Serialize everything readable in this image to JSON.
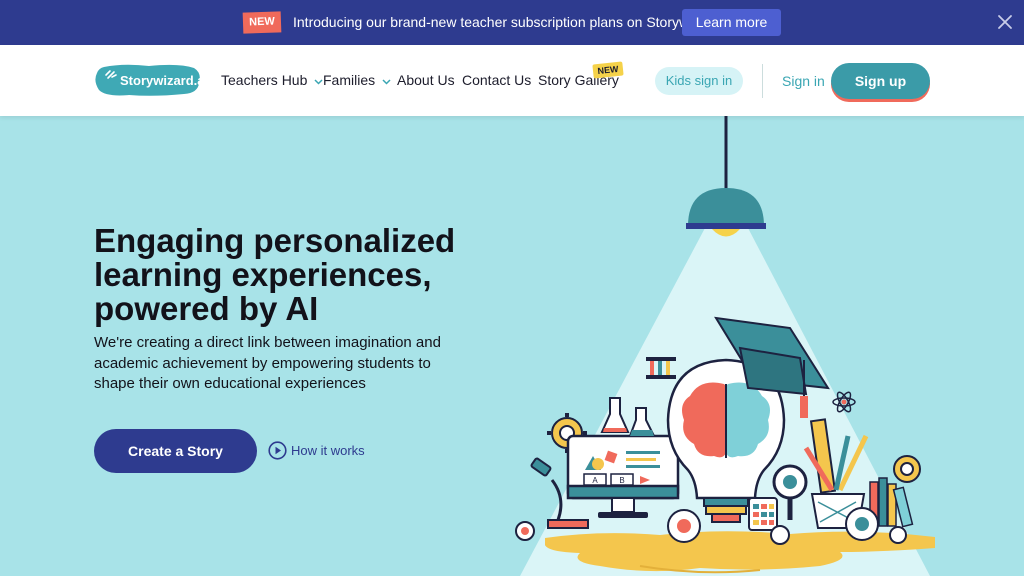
{
  "announcement": {
    "badge": "NEW",
    "message": "Introducing our brand-new teacher subscription plans on Storywizard.ai",
    "learn_more": "Learn more",
    "close_icon": "close-icon"
  },
  "header": {
    "logo_text": "Storywizard.ai",
    "nav": {
      "teachers_hub": "Teachers Hub",
      "families": "Families",
      "about": "About Us",
      "contact": "Contact Us",
      "story_gallery": "Story Gallery",
      "new_tag": "NEW"
    },
    "kids_sign_in": "Kids sign in",
    "sign_in": "Sign in",
    "sign_up": "Sign up"
  },
  "hero": {
    "title_line1": "Engaging personalized",
    "title_line2": "learning experiences,",
    "title_line3": "powered by AI",
    "subtitle": "We're creating a direct link between imagination and academic achievement by empowering students to shape their own educational experiences",
    "cta": "Create a Story",
    "how_it_works": "How it works"
  },
  "illustration": {
    "screen_buttons": [
      "A",
      "B"
    ]
  },
  "colors": {
    "announce_bg": "#2e3b8f",
    "hero_bg": "#a8e3e8",
    "accent_teal": "#3b9ba8",
    "accent_coral": "#f06a5b",
    "cta_navy": "#2e3b8f"
  }
}
